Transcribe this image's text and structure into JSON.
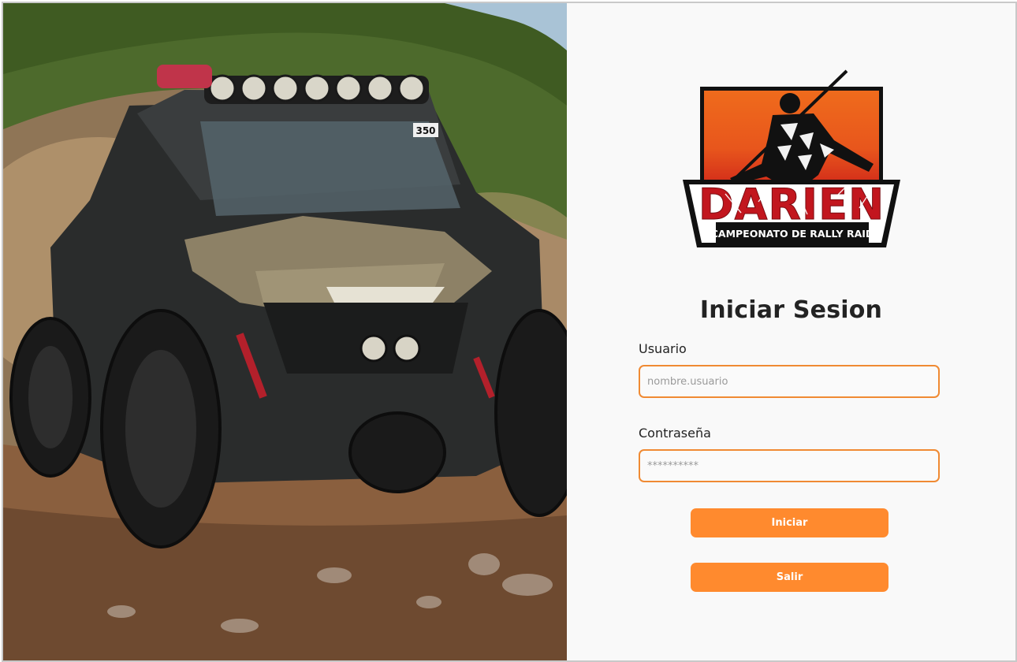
{
  "login": {
    "title": "Iniciar Sesion",
    "username_label": "Usuario",
    "username_placeholder": "nombre.usuario",
    "password_label": "Contraseña",
    "password_placeholder": "**********",
    "login_button": "Iniciar",
    "exit_button": "Salir"
  },
  "logo": {
    "brand_text": "DARIEN",
    "subtitle": "CAMPEONATO DE RALLY RAID",
    "vehicle_number": "350"
  },
  "colors": {
    "accent": "#ff8a2e",
    "field_border": "#f08a33",
    "logo_orange": "#e8561c",
    "logo_red": "#c2161e",
    "title_text": "#232323"
  }
}
